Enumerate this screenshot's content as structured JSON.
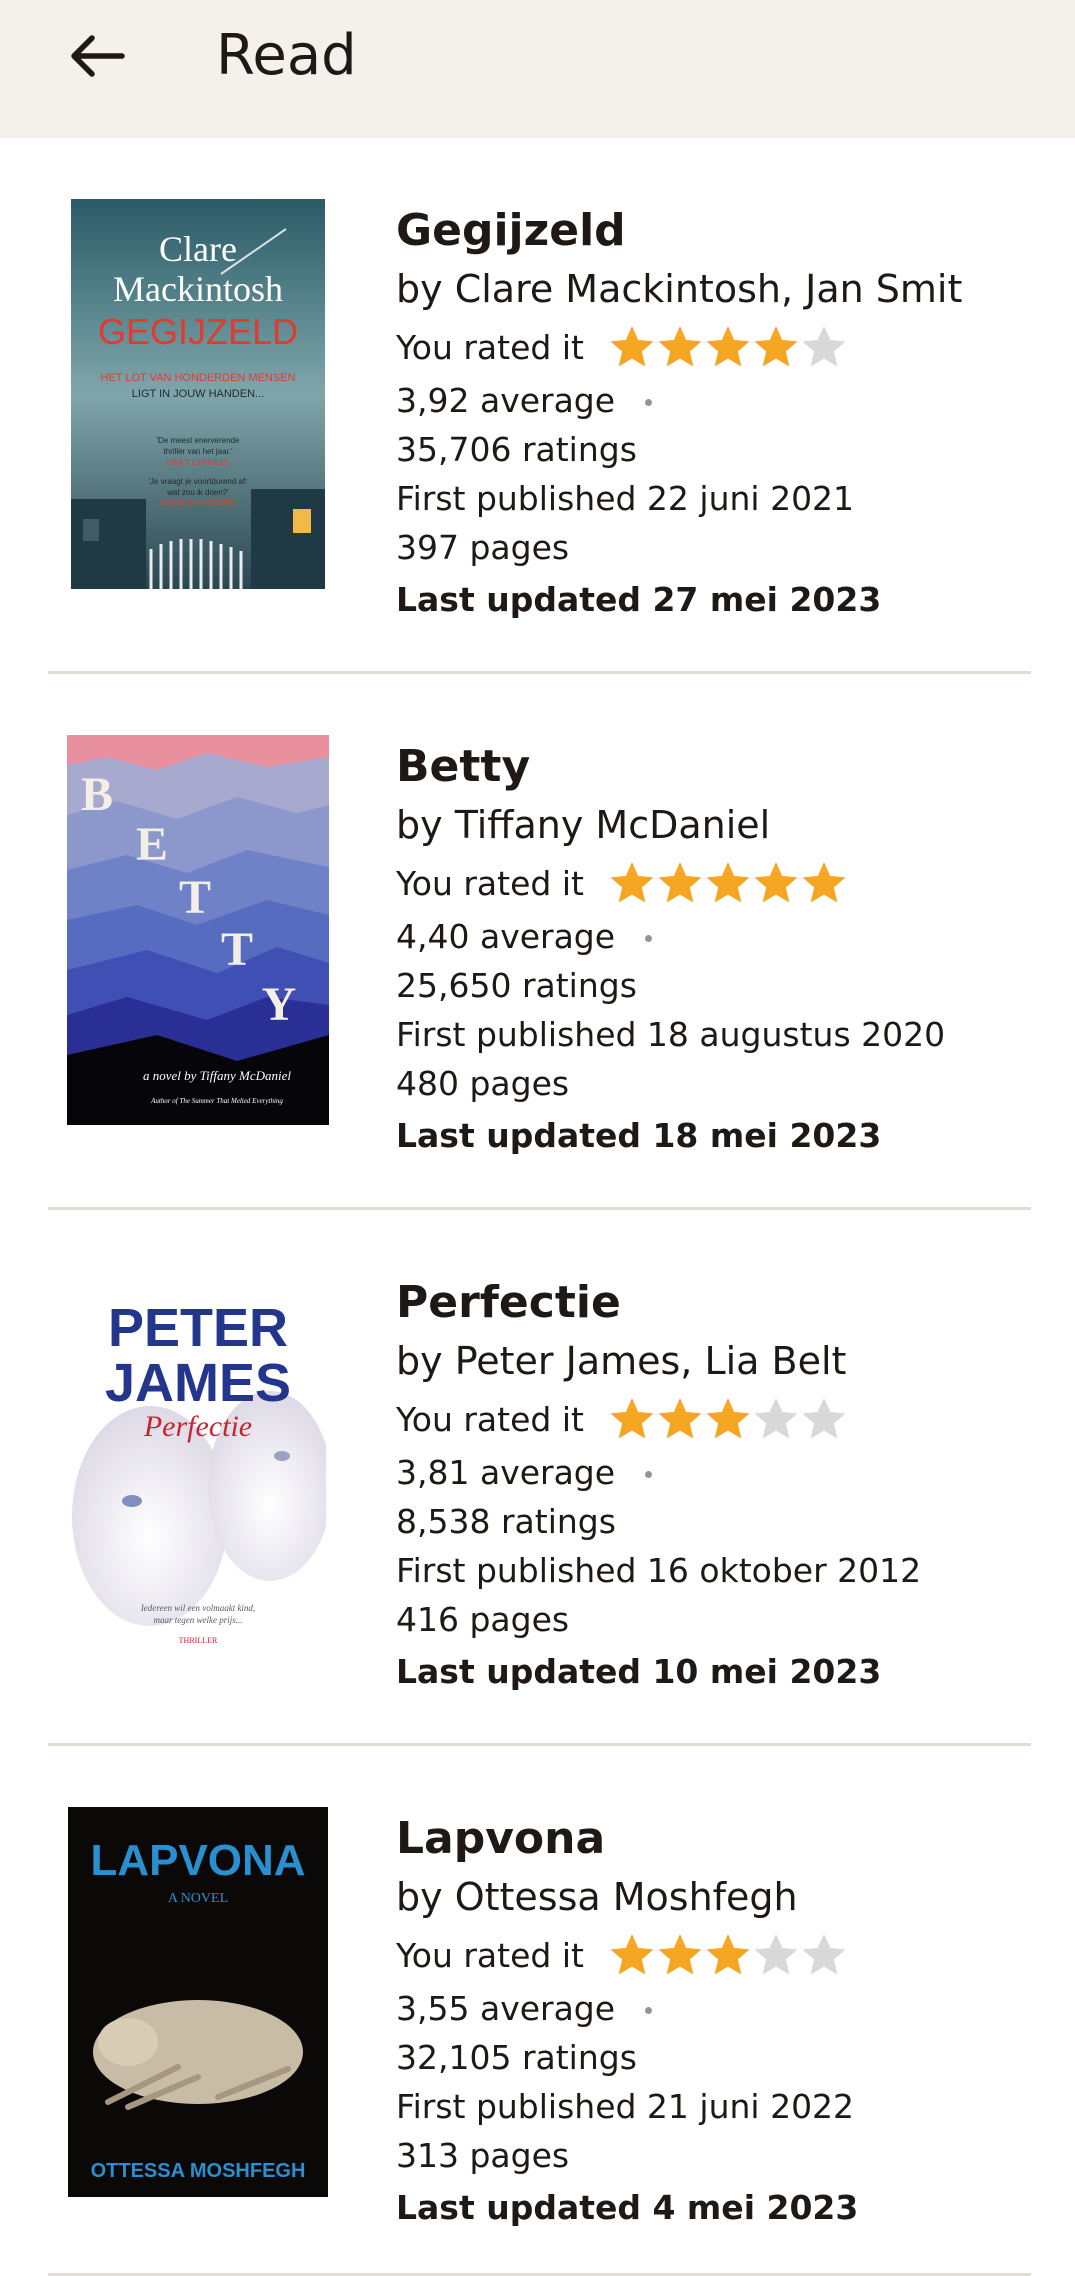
{
  "header": {
    "title": "Read",
    "back_icon": "arrow-left-icon"
  },
  "colors": {
    "appbar_bg": "#f4f1ea",
    "star_filled": "#f5a623",
    "star_empty": "#d8d8d8",
    "divider": "#e2ded6"
  },
  "rated_label": "You rated it",
  "books": [
    {
      "title": "Gegijzeld",
      "author": "by Clare Mackintosh, Jan Smit",
      "user_rating": 4,
      "average": "3,92 average",
      "ratings": "35,706 ratings",
      "first_published": "First published 22 juni 2021",
      "pages": "397 pages",
      "last_updated": "Last updated 27 mei 2023",
      "cover": {
        "author_line1": "Clare",
        "author_line2": "Mackintosh",
        "title": "GEGIJZELD",
        "tagline1": "HET LOT VAN HONDERDEN MENSEN",
        "tagline2": "LIGT IN JOUW HANDEN...",
        "quote1a": "'De meest enerverende",
        "quote1b": "thriller van het jaar.'",
        "quote1src": "DAILY EXPRESS",
        "quote2a": "'Je vraagt je voortdurend af:",
        "quote2b": "wat zou ik doen?'",
        "quote2src": "KARIN SLAUGHTER"
      }
    },
    {
      "title": "Betty",
      "author": "by Tiffany McDaniel",
      "user_rating": 5,
      "average": "4,40 average",
      "ratings": "25,650 ratings",
      "first_published": "First published 18 augustus 2020",
      "pages": "480 pages",
      "last_updated": "Last updated 18 mei 2023",
      "cover": {
        "letters": [
          "B",
          "E",
          "T",
          "T",
          "Y"
        ],
        "subtitle": "a novel by Tiffany McDaniel",
        "byline": "Author of The Summer That Melted Everything"
      }
    },
    {
      "title": "Perfectie",
      "author": "by Peter James, Lia Belt",
      "user_rating": 3,
      "average": "3,81 average",
      "ratings": "8,538 ratings",
      "first_published": "First published 16 oktober 2012",
      "pages": "416 pages",
      "last_updated": "Last updated 10 mei 2023",
      "cover": {
        "author_line1": "PETER",
        "author_line2": "JAMES",
        "title": "Perfectie",
        "tagline1": "Iedereen wil een volmaakt kind,",
        "tagline2": "maar tegen welke prijs...",
        "genre": "THRILLER"
      }
    },
    {
      "title": "Lapvona",
      "author": "by Ottessa Moshfegh",
      "user_rating": 3,
      "average": "3,55 average",
      "ratings": "32,105 ratings",
      "first_published": "First published 21 juni 2022",
      "pages": "313 pages",
      "last_updated": "Last updated 4 mei 2023",
      "cover": {
        "title": "LAPVONA",
        "subtitle": "A NOVEL",
        "author": "OTTESSA MOSHFEGH"
      }
    }
  ]
}
